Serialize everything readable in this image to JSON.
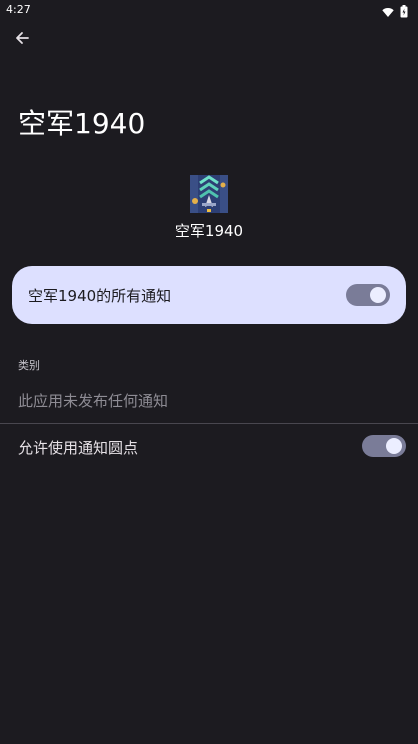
{
  "status_bar": {
    "time": "4:27",
    "icons": [
      "wifi-icon",
      "battery-icon"
    ]
  },
  "header": {
    "back_icon": "arrow-left-icon"
  },
  "page": {
    "title": "空军1940"
  },
  "app": {
    "name": "空军1940",
    "icon": "app-icon"
  },
  "master_toggle": {
    "label": "空军1940的所有通知",
    "checked": true
  },
  "categories": {
    "header": "类别",
    "empty_text": "此应用未发布任何通知"
  },
  "notification_dots": {
    "label": "允许使用通知圆点",
    "checked": true
  },
  "colors": {
    "background": "#1c1b20",
    "card": "#dde0ff",
    "switch_track": "#7a7c98",
    "switch_thumb": "#eceeff"
  }
}
